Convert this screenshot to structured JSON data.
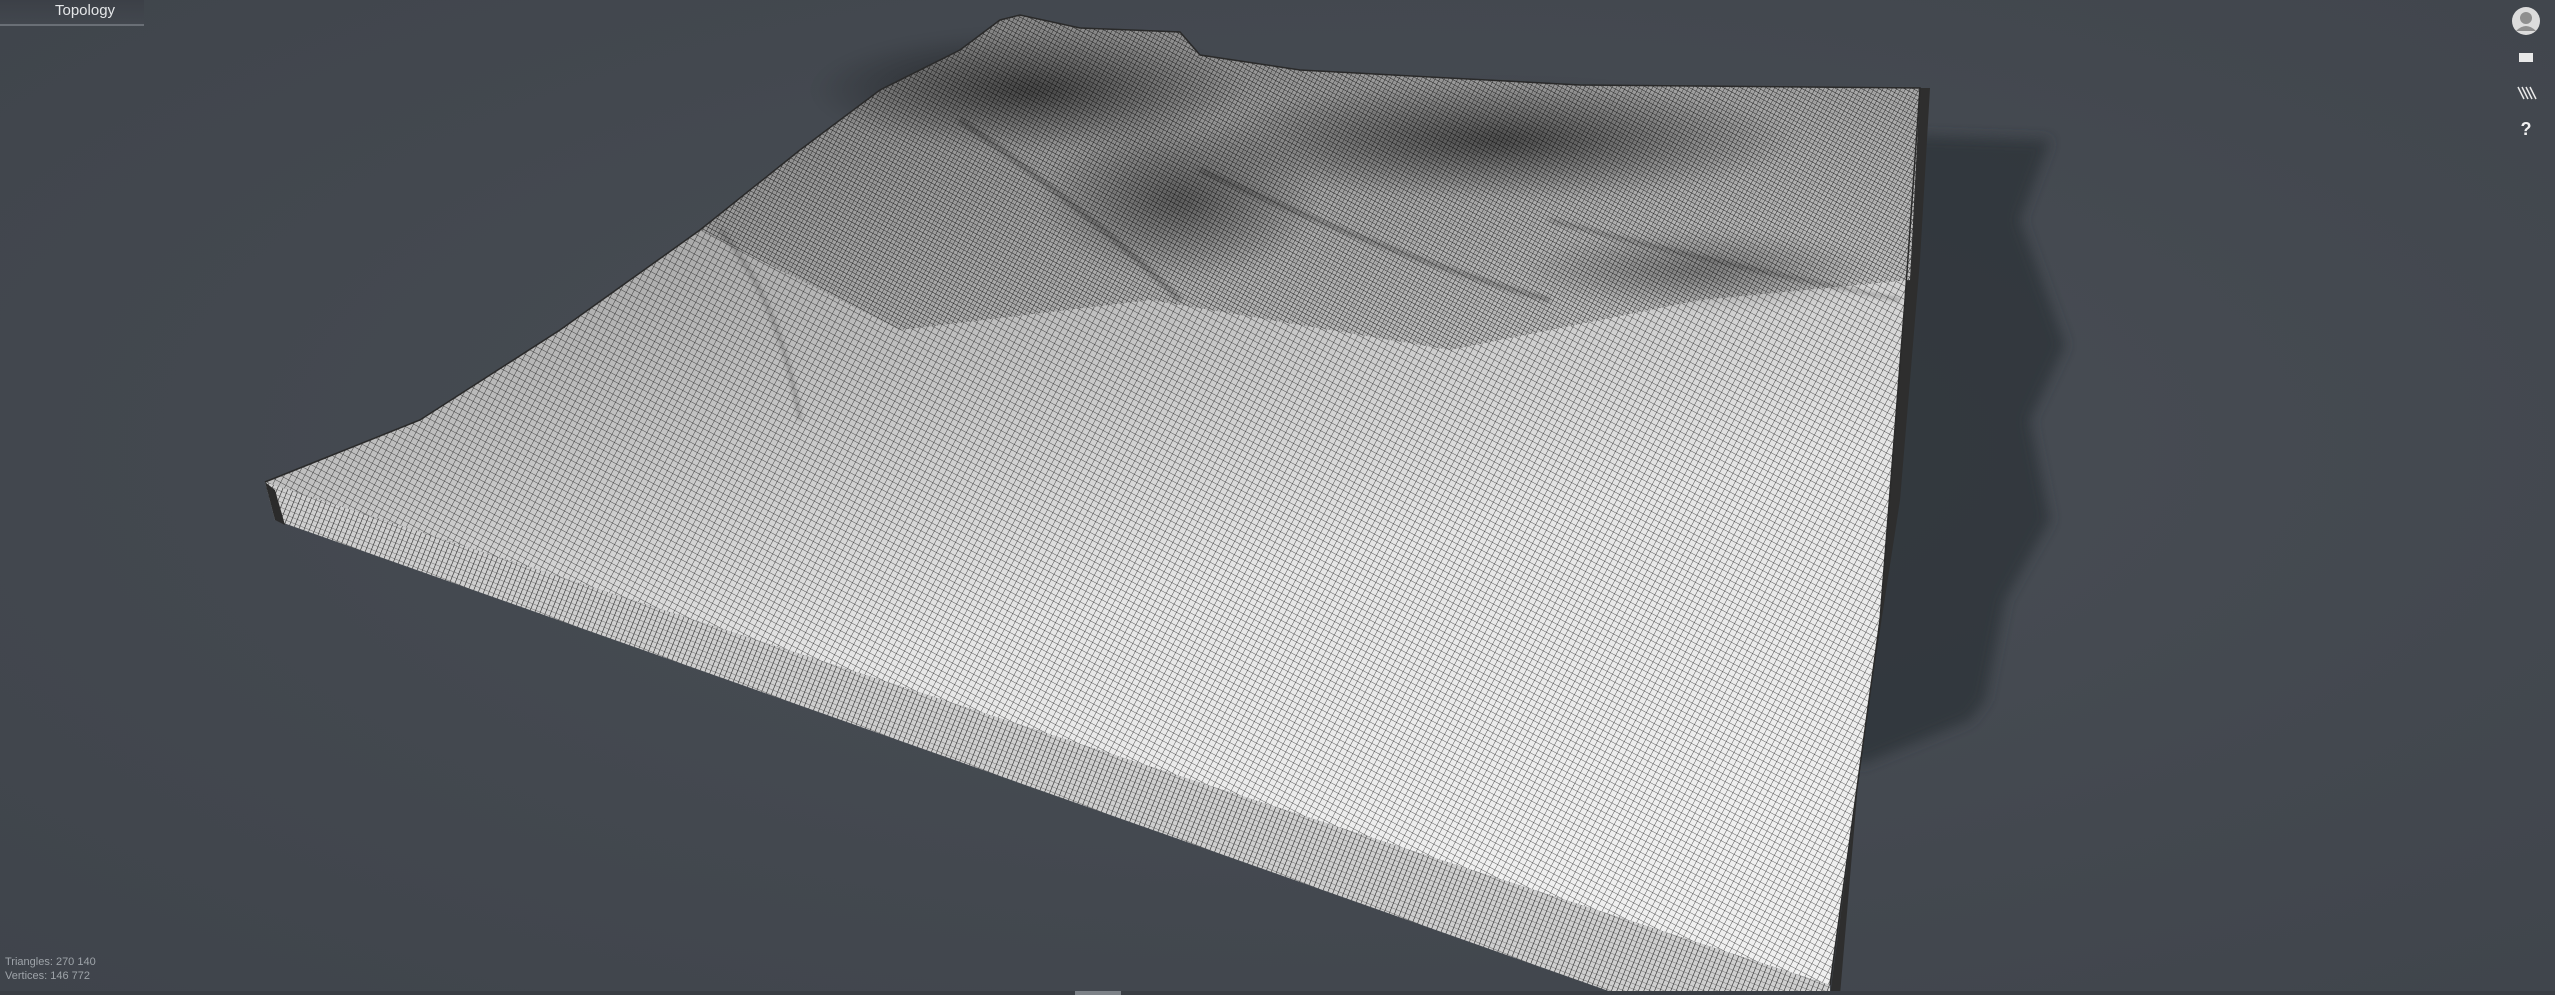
{
  "viewer": {
    "mode_title": "Topology",
    "stats": {
      "triangles": "Triangles: 270 140",
      "vertices": "Vertices: 146 772"
    }
  },
  "toolbar": {
    "buttons": [
      {
        "icon": "avatar-icon"
      },
      {
        "icon": "solid-view-icon"
      },
      {
        "icon": "wireframe-view-icon"
      },
      {
        "icon": "help-icon",
        "label": "?"
      }
    ]
  },
  "colors": {
    "background": "#454a51",
    "mesh_light": "#e6e6e6",
    "mesh_dark": "#1e1e1e",
    "shadow": "#34383e"
  }
}
